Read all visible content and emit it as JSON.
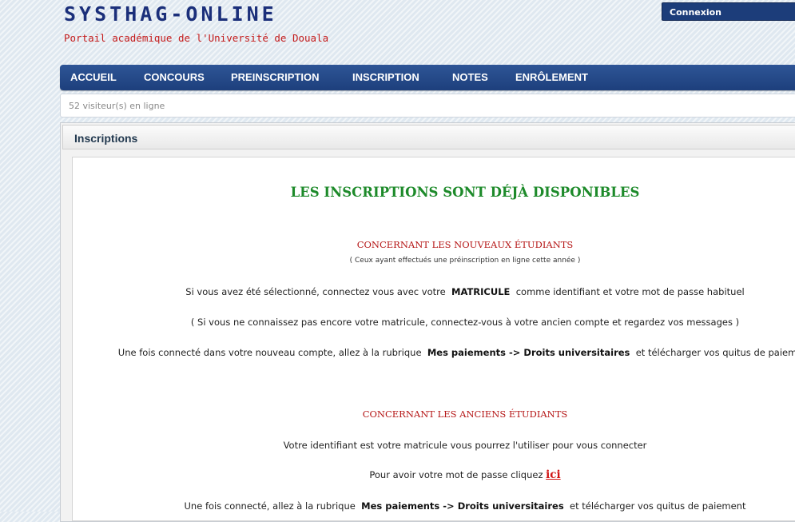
{
  "header": {
    "site_title": "SYSTHAG-ONLINE",
    "subtitle": "Portail académique de l'Université de Douala",
    "login_label": "Connexion"
  },
  "nav": {
    "items": [
      {
        "label": "ACCUEIL"
      },
      {
        "label": "CONCOURS"
      },
      {
        "label": "PREINSCRIPTION"
      },
      {
        "label": "INSCRIPTION"
      },
      {
        "label": "NOTES"
      },
      {
        "label": "ENRÔLEMENT"
      }
    ]
  },
  "visitors": {
    "text": "52 visiteur(s) en ligne"
  },
  "panel": {
    "title": "Inscriptions"
  },
  "content": {
    "headline": "LES INSCRIPTIONS SONT DÉJÀ DISPONIBLES",
    "new_students": {
      "heading": "CONCERNANT LES NOUVEAUX ÉTUDIANTS",
      "note": "( Ceux ayant effectués une préinscription en ligne cette année )",
      "line1_a": "Si vous avez été sélectionné, connectez vous avec votre",
      "line1_term": "MATRICULE",
      "line1_b": "comme identifiant et votre mot de passe habituel",
      "line2": "( Si vous ne connaissez pas encore votre matricule, connectez-vous à votre ancien compte et regardez vos messages )",
      "line3_a": "Une fois connecté dans votre nouveau compte, allez à la rubrique",
      "line3_term": "Mes paiements -> Droits universitaires",
      "line3_b": "et télécharger vos quitus de paiement"
    },
    "old_students": {
      "heading": "CONCERNANT LES ANCIENS ÉTUDIANTS",
      "line1": "Votre identifiant est votre matricule vous pourrez l'utiliser pour vous connecter",
      "line2_a": "Pour avoir votre mot de passe cliquez",
      "line2_link": "ici",
      "line3_a": "Une fois connecté, allez à la rubrique",
      "line3_term": "Mes paiements -> Droits universitaires",
      "line3_b": "et télécharger vos quitus de paiement"
    }
  }
}
